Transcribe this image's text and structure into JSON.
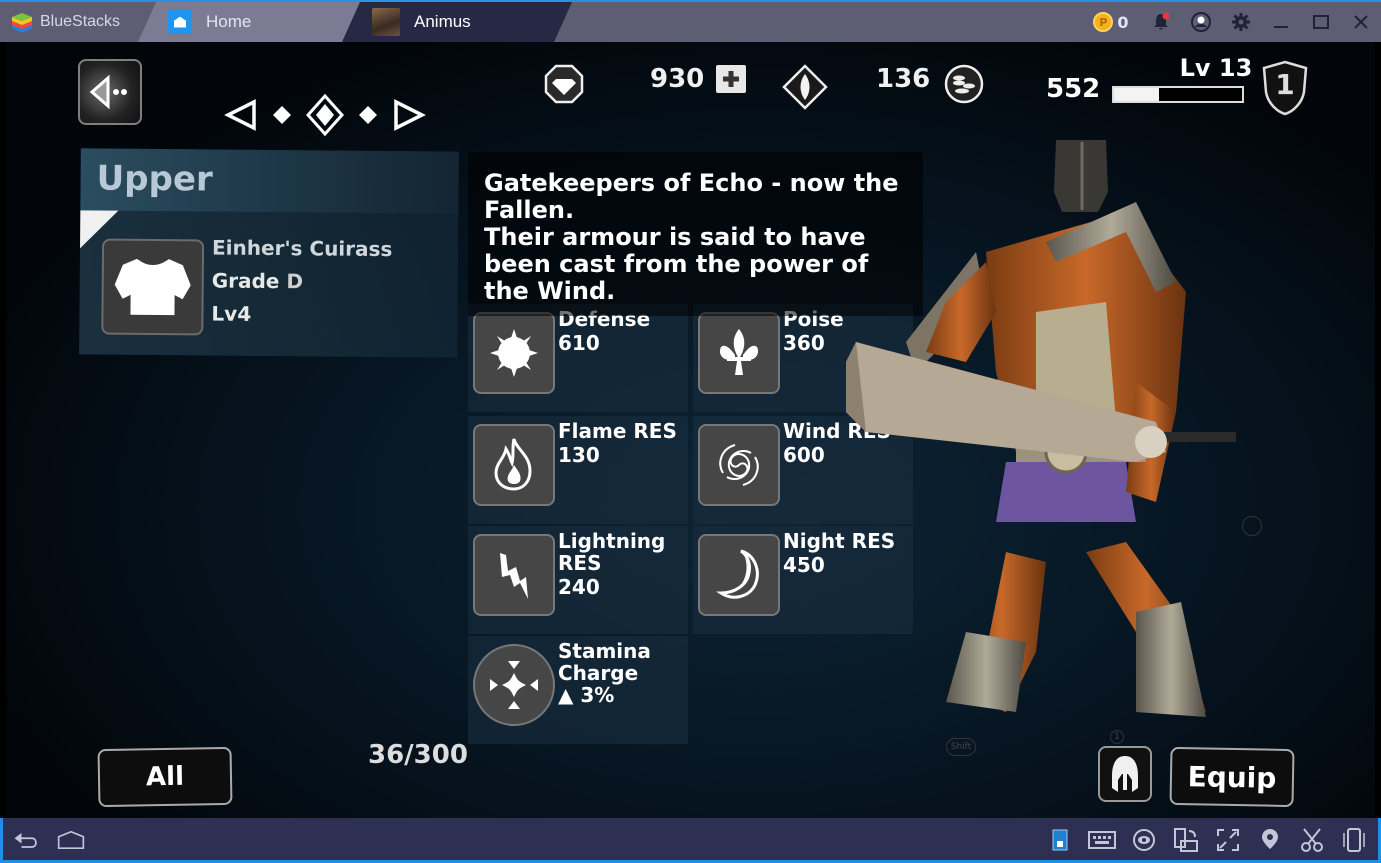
{
  "window": {
    "brand": "BlueStacks",
    "tabs": [
      {
        "label": "Home",
        "icon": "home-icon",
        "active": false
      },
      {
        "label": "Animus",
        "icon": "game-thumbnail",
        "active": true
      }
    ],
    "coin_count": "0",
    "controls": [
      "notification-bell",
      "account",
      "settings",
      "minimize",
      "maximize",
      "close"
    ]
  },
  "hud": {
    "gems": "930",
    "soul_shards": "136",
    "gold": "552",
    "level_label": "Lv 13",
    "xp_progress_percent": 35,
    "rank_badge": "1"
  },
  "equipment": {
    "slot_title": "Upper",
    "item_name": "Einher's Cuirass",
    "grade_label": "Grade",
    "grade_value": "D",
    "level": "Lv4",
    "description": "Gatekeepers of Echo - now the Fallen.\nTheir armour is said to have been cast from the power of the Wind."
  },
  "stats": [
    {
      "label": "Defense",
      "value": "610",
      "icon": "defense-icon"
    },
    {
      "label": "Poise",
      "value": "360",
      "icon": "fleur-de-lis-icon"
    },
    {
      "label": "Flame RES",
      "value": "130",
      "icon": "flame-icon"
    },
    {
      "label": "Wind RES",
      "value": "600",
      "icon": "wind-spiral-icon"
    },
    {
      "label": "Lightning RES",
      "value": "240",
      "icon": "lightning-icon"
    },
    {
      "label": "Night RES",
      "value": "450",
      "icon": "crescent-moon-icon"
    },
    {
      "label": "Stamina Charge",
      "value": "▲ 3%",
      "icon": "stamina-icon"
    }
  ],
  "footer": {
    "filter_label": "All",
    "inventory_count": "36/300",
    "equip_label": "Equip",
    "hint_shift": "Shift",
    "hint_one": "1"
  },
  "bottombar": {
    "left": [
      "back",
      "home"
    ],
    "right": [
      "keymapping-toggle",
      "keyboard",
      "eye-view",
      "rotate-screen",
      "fullscreen",
      "location",
      "screenshot-scissors",
      "shake-device"
    ]
  }
}
